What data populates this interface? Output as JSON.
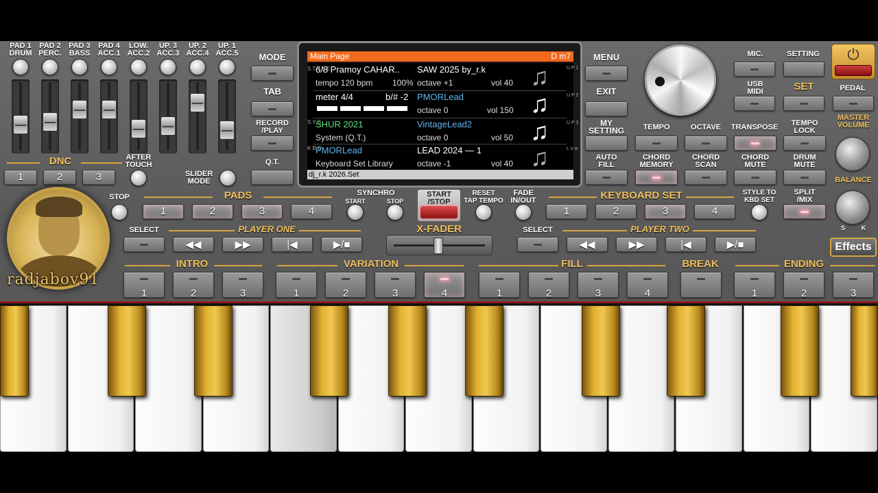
{
  "pads": [
    {
      "l1": "PAD 1",
      "l2": "DRUM"
    },
    {
      "l1": "PAD 2",
      "l2": "PERC."
    },
    {
      "l1": "PAD 3",
      "l2": "BASS"
    },
    {
      "l1": "PAD 4",
      "l2": "ACC.1"
    },
    {
      "l1": "LOW.",
      "l2": "ACC.2"
    },
    {
      "l1": "UP. 3",
      "l2": "ACC.3"
    },
    {
      "l1": "UP. 2",
      "l2": "ACC.4"
    },
    {
      "l1": "UP. 1",
      "l2": "ACC.5"
    }
  ],
  "dnc": {
    "label": "DNC",
    "buttons": [
      "1",
      "2",
      "3"
    ]
  },
  "after_touch": "AFTER\nTOUCH",
  "slider_mode": "SLIDER\nMODE",
  "left_menu": {
    "mode": "MODE",
    "tab": "TAB",
    "record": "RECORD\n/PLAY",
    "qt": "Q.T."
  },
  "screen": {
    "title": "Main Page",
    "chord": "D m7",
    "style_name": "6/8 Pramoy CAHAR..",
    "tempo": "tempo 120 bpm",
    "tempo_pct": "100%",
    "meter": "meter 4/4",
    "key": "b/# -2",
    "up1_name": "SAW 2025 by_r.k",
    "up1_octave": "octave +1",
    "up1_vol": "vol 40",
    "up2_name": "PMORLead",
    "up2_octave": "octave  0",
    "up2_vol": "vol 150",
    "sys_name": "SHUR 2021",
    "sys_sub": "System (Q.T.)",
    "up3_name": "VintageLead2",
    "up3_octave": "octave  0",
    "up3_vol": "vol 50",
    "kbd_name": "PMORLead",
    "kbd_sub": "Keyboard Set Library",
    "low_name": "LEAD 2024 — 1",
    "low_octave": "octave -1",
    "low_vol": "vol 40",
    "side_style": "S T Y L E",
    "side_sys": "S Y S",
    "side_kbd": "K B D",
    "side_up1": "U P 1",
    "side_up2": "U P 2",
    "side_up3": "U P 3",
    "side_low": "L o w",
    "footer": "dj_r.k 2026.Set"
  },
  "right_menu": {
    "menu": "MENU",
    "exit": "EXIT",
    "my_setting": "MY\nSETTING",
    "auto_fill": "AUTO\nFILL"
  },
  "top_right": {
    "mic": "MIC.",
    "setting": "SETTING",
    "usb_midi": "USB\nMIDI",
    "set": "SET",
    "pedal": "PEDAL",
    "master_volume": "MASTER\nVOLUME",
    "balance": "BALANCE",
    "bal_s": "S",
    "bal_k": "K"
  },
  "controls": {
    "tempo": "TEMPO",
    "octave": "OCTAVE",
    "transpose": "TRANSPOSE",
    "tempo_lock": "TEMPO\nLOCK",
    "chord_memory": "CHORD\nMEMORY",
    "chord_scan": "CHORD\nSCAN",
    "chord_mute": "CHORD\nMUTE",
    "drum_mute": "DRUM\nMUTE"
  },
  "row_pads": {
    "stop": "STOP",
    "pads_label": "PADS",
    "buttons": [
      "1",
      "2",
      "3",
      "4"
    ]
  },
  "synchro": {
    "label": "SYNCHRO",
    "start": "START",
    "stop": "STOP"
  },
  "start_stop": "START\n/STOP",
  "reset": "RESET\nTAP TEMPO",
  "fade": "FADE\nIN/OUT",
  "keyboard_set": {
    "label": "KEYBOARD SET",
    "buttons": [
      "1",
      "2",
      "3",
      "4"
    ]
  },
  "style_to_kbd": "STYLE TO\nKBD SET",
  "split_mix": "SPLIT\n/MIX",
  "player_one": {
    "select": "SELECT",
    "label": "PLAYER ONE"
  },
  "player_two": {
    "select": "SELECT",
    "label": "PLAYER TWO"
  },
  "x_fader": "X-FADER",
  "effects": "Effects",
  "sections": {
    "intro": "INTRO",
    "variation": "VARIATION",
    "fill": "FILL",
    "break": "BREAK",
    "ending": "ENDING"
  },
  "intro_buttons": [
    "1",
    "2",
    "3"
  ],
  "variation_buttons": [
    "1",
    "2",
    "3",
    "4"
  ],
  "fill_buttons": [
    "1",
    "2",
    "3",
    "4"
  ],
  "ending_buttons": [
    "1",
    "2",
    "3"
  ],
  "avatar_name": "radjabov91",
  "icons": {
    "power": "power-icon",
    "note": "music-note-icon",
    "prev": "rewind-icon",
    "next": "fast-forward-icon",
    "restart": "skip-back-icon",
    "play": "play-stop-icon"
  }
}
